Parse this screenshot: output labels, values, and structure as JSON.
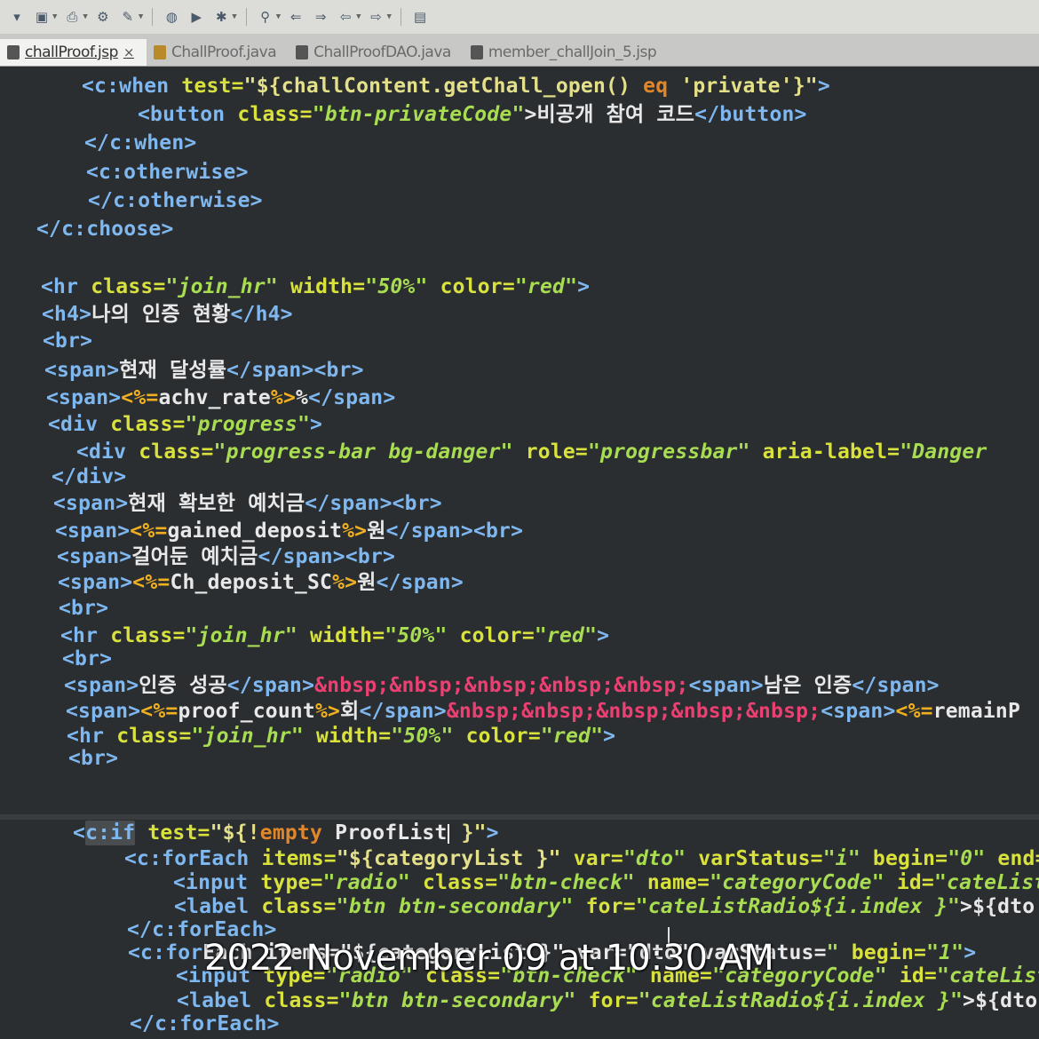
{
  "toolbar": {
    "icons": [
      "new-icon",
      "save-icon",
      "print-icon",
      "settings-icon",
      "pen-icon",
      "globe-icon",
      "run-icon",
      "debug-icon",
      "search-icon",
      "back-icon",
      "forward-icon",
      "nav-left-icon",
      "nav-right-icon",
      "nav-prev-icon",
      "nav-next-icon",
      "window-icon"
    ]
  },
  "tabs": [
    {
      "label": "challProof.jsp",
      "active": true,
      "close": "×",
      "icon": "jsp"
    },
    {
      "label": "ChallProof.java",
      "active": false,
      "icon": "java"
    },
    {
      "label": "ChallProofDAO.java",
      "active": false,
      "icon": "jsp"
    },
    {
      "label": "member_challJoin_5.jsp",
      "active": false,
      "icon": "jsp"
    }
  ],
  "code": {
    "l1": [
      "<c:when ",
      "test=",
      "\"${challContent.getChall_open() ",
      "eq",
      " 'private'}\"",
      ">"
    ],
    "l2": [
      "<button ",
      "class=",
      "\"btn-privateCode\"",
      ">비공개 참여 코드",
      "</button>"
    ],
    "l3": [
      "</c:when>"
    ],
    "l4": [
      "<c:otherwise>"
    ],
    "l5": [
      "</c:otherwise>"
    ],
    "l6": [
      "</c:choose>"
    ],
    "l7": [
      "<hr ",
      "class=",
      "\"join_hr\"",
      " width=",
      "\"50%\"",
      " color=",
      "\"red\"",
      ">"
    ],
    "l8": [
      "<h4>",
      "나의 인증 현황",
      "</h4>"
    ],
    "l9": [
      "<br>"
    ],
    "l10": [
      "<span>",
      "현재 달성률",
      "</span>",
      "<br>"
    ],
    "l11": [
      "<span>",
      "<%=",
      "achv_rate",
      "%>",
      "%",
      "</span>"
    ],
    "l12": [
      "<div ",
      "class=",
      "\"progress\"",
      ">"
    ],
    "l13": [
      "<div ",
      "class=",
      "\"progress-bar bg-danger\"",
      " role=",
      "\"progressbar\"",
      " aria-label=",
      "\"Danger"
    ],
    "l14": [
      "</div>"
    ],
    "l15": [
      "<span>",
      "현재 확보한 예치금",
      "</span>",
      "<br>"
    ],
    "l16": [
      "<span>",
      "<%=",
      "gained_deposit",
      "%>",
      "원",
      "</span>",
      "<br>"
    ],
    "l17": [
      "<span>",
      "걸어둔 예치금",
      "</span>",
      "<br>"
    ],
    "l18": [
      "<span>",
      "<%=",
      "Ch_deposit_SC",
      "%>",
      "원",
      "</span>"
    ],
    "l19": [
      "<br>"
    ],
    "l20": [
      "<hr ",
      "class=",
      "\"join_hr\"",
      " width=",
      "\"50%\"",
      " color=",
      "\"red\"",
      ">"
    ],
    "l21": [
      "<br>"
    ],
    "l22": [
      "<span>",
      "인증 성공",
      "</span>",
      "&nbsp;&nbsp;&nbsp;&nbsp;&nbsp;",
      "<span>",
      "남은 인증",
      "</span>"
    ],
    "l23": [
      "<span>",
      "<%=",
      "proof_count",
      "%>",
      "회",
      "</span>",
      "&nbsp;&nbsp;&nbsp;&nbsp;&nbsp;",
      "<span>",
      "<%=",
      "remainP"
    ],
    "l24": [
      "<hr ",
      "class=",
      "\"join_hr\"",
      " width=",
      "\"50%\"",
      " color=",
      "\"red\"",
      ">"
    ],
    "l25": [
      "<br>"
    ],
    "l26": [
      "<",
      "c:if",
      " test=",
      "\"${!",
      "empty",
      " ProofList",
      " }\"",
      ">"
    ],
    "l27": [
      "<c:forEach ",
      "items=",
      "\"${categoryList }\"",
      " var=",
      "\"dto\"",
      " varStatus=",
      "\"i\"",
      " begin=",
      "\"0\"",
      " end="
    ],
    "l28": [
      "<input ",
      "type=",
      "\"radio\"",
      " class=",
      "\"btn-check\"",
      " name=",
      "\"categoryCode\"",
      " id=",
      "\"cateList"
    ],
    "l29": [
      "<label ",
      "class=",
      "\"btn btn-secondary\"",
      " for=",
      "\"cateListRadio${i.index }\"",
      ">${dto."
    ],
    "l30": [
      "</c:forEach>"
    ],
    "l31": [
      "<c:for",
      "Each items=\"${categoryList }\" var=\"dto\" varStatus=",
      "\"",
      " begin=",
      "\"1\"",
      ">"
    ],
    "l32": [
      "<input ",
      "type=",
      "\"radio\"",
      " class=",
      "\"btn-check\"",
      " name=",
      "\"categoryCode\"",
      " id=",
      "\"cateList"
    ],
    "l33": [
      "<label ",
      "class=",
      "\"btn btn-secondary\"",
      " for=",
      "\"cateListRadio${i.index }\"",
      ">${dto."
    ],
    "l34": [
      "</c:forEach>"
    ]
  },
  "overlay": {
    "timestamp": "2022 November 09 at 10:30 AM"
  }
}
